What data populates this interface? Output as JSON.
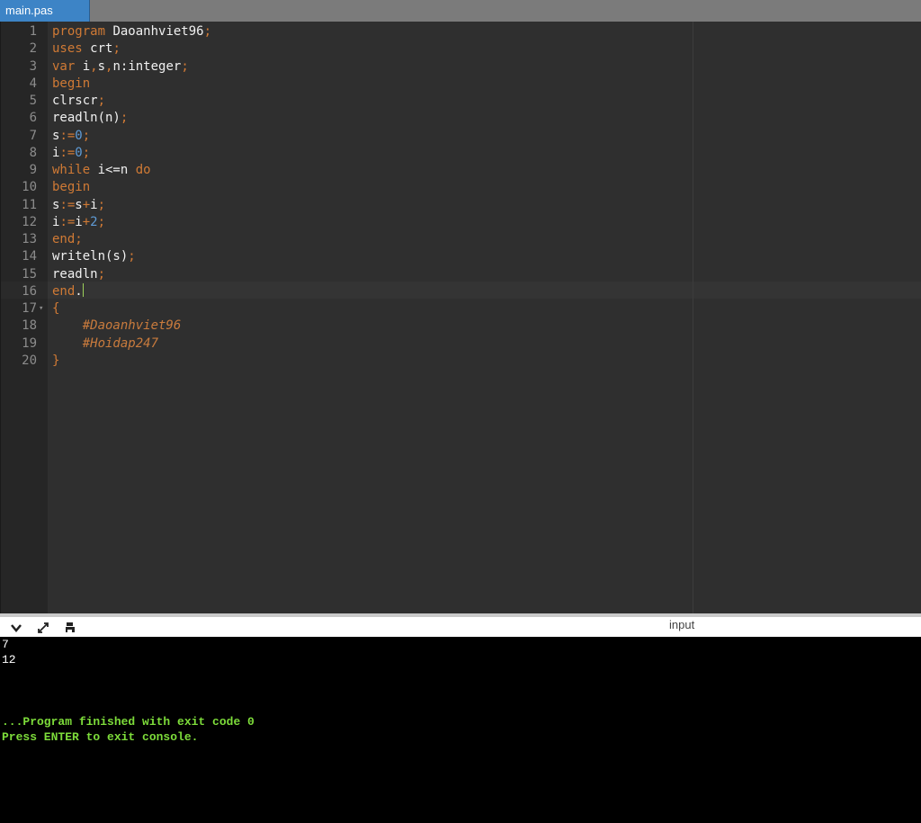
{
  "tab": {
    "title": "main.pas"
  },
  "editor": {
    "lines": [
      {
        "n": "1",
        "t": [
          [
            "kw",
            "program "
          ],
          [
            "id",
            "Daoanhviet96"
          ],
          [
            "op",
            ";"
          ]
        ]
      },
      {
        "n": "2",
        "t": [
          [
            "kw",
            "uses "
          ],
          [
            "id",
            "crt"
          ],
          [
            "op",
            ";"
          ]
        ]
      },
      {
        "n": "3",
        "t": [
          [
            "kw",
            "var "
          ],
          [
            "id",
            "i"
          ],
          [
            "op",
            ","
          ],
          [
            "id",
            "s"
          ],
          [
            "op",
            ","
          ],
          [
            "id",
            "n:integer"
          ],
          [
            "op",
            ";"
          ]
        ]
      },
      {
        "n": "4",
        "t": [
          [
            "kw",
            "begin"
          ]
        ]
      },
      {
        "n": "5",
        "t": [
          [
            "id",
            "clrscr"
          ],
          [
            "op",
            ";"
          ]
        ]
      },
      {
        "n": "6",
        "t": [
          [
            "id",
            "readln(n)"
          ],
          [
            "op",
            ";"
          ]
        ]
      },
      {
        "n": "7",
        "t": [
          [
            "id",
            "s"
          ],
          [
            "op",
            ":="
          ],
          [
            "num",
            "0"
          ],
          [
            "op",
            ";"
          ]
        ]
      },
      {
        "n": "8",
        "t": [
          [
            "id",
            "i"
          ],
          [
            "op",
            ":="
          ],
          [
            "num",
            "0"
          ],
          [
            "op",
            ";"
          ]
        ]
      },
      {
        "n": "9",
        "t": [
          [
            "kw",
            "while "
          ],
          [
            "id",
            "i<=n "
          ],
          [
            "kw",
            "do"
          ]
        ]
      },
      {
        "n": "10",
        "t": [
          [
            "kw",
            "begin"
          ]
        ]
      },
      {
        "n": "11",
        "t": [
          [
            "id",
            "s"
          ],
          [
            "op",
            ":="
          ],
          [
            "id",
            "s"
          ],
          [
            "op",
            "+"
          ],
          [
            "id",
            "i"
          ],
          [
            "op",
            ";"
          ]
        ]
      },
      {
        "n": "12",
        "t": [
          [
            "id",
            "i"
          ],
          [
            "op",
            ":="
          ],
          [
            "id",
            "i"
          ],
          [
            "op",
            "+"
          ],
          [
            "num",
            "2"
          ],
          [
            "op",
            ";"
          ]
        ]
      },
      {
        "n": "13",
        "t": [
          [
            "kw",
            "end"
          ],
          [
            "op",
            ";"
          ]
        ]
      },
      {
        "n": "14",
        "t": [
          [
            "id",
            "writeln(s)"
          ],
          [
            "op",
            ";"
          ]
        ]
      },
      {
        "n": "15",
        "t": [
          [
            "id",
            "readln"
          ],
          [
            "op",
            ";"
          ]
        ]
      },
      {
        "n": "16",
        "t": [
          [
            "kw",
            "end"
          ],
          [
            "id",
            "."
          ]
        ],
        "cursor": true
      },
      {
        "n": "17",
        "t": [
          [
            "op",
            "{"
          ]
        ],
        "fold": true
      },
      {
        "n": "18",
        "t": [
          [
            "cm",
            "    #Daoanhviet96"
          ]
        ]
      },
      {
        "n": "19",
        "t": [
          [
            "cm",
            "    #Hoidap247"
          ]
        ]
      },
      {
        "n": "20",
        "t": [
          [
            "op",
            "}"
          ]
        ]
      }
    ]
  },
  "console_bar": {
    "icons": [
      "chevron-down-icon",
      "expand-icon",
      "print-icon"
    ],
    "input_label": "input"
  },
  "console": {
    "lines": [
      "7",
      "12"
    ],
    "finish_line": "...Program finished with exit code 0",
    "exit_line": "Press ENTER to exit console."
  }
}
